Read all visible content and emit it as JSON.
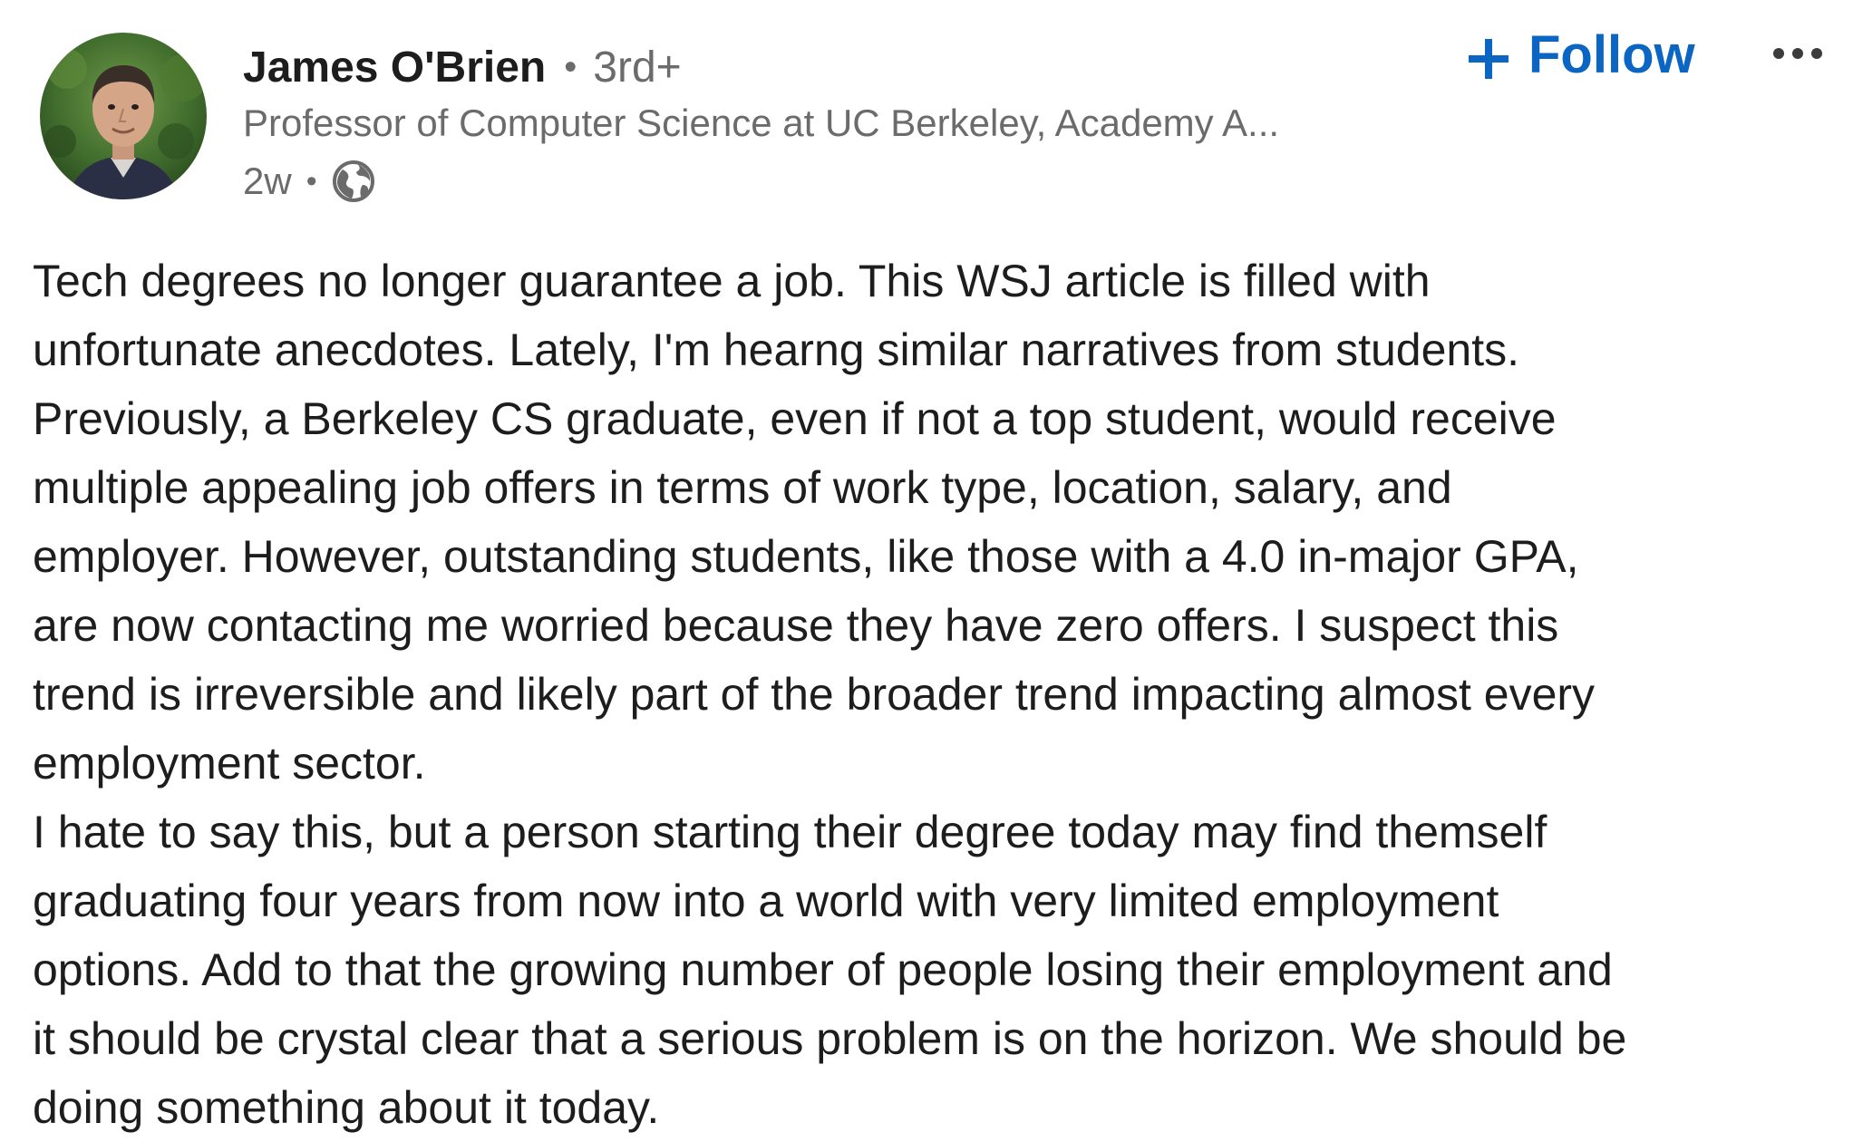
{
  "author": {
    "name": "James O'Brien",
    "degree": "3rd+",
    "headline": "Professor of Computer Science at UC Berkeley, Academy A...",
    "posted_ago": "2w",
    "avatar_icon": "profile-photo",
    "visibility_icon": "globe-icon"
  },
  "actions": {
    "follow_label": "Follow",
    "follow_icon": "plus-icon",
    "more_icon": "more-options-icon"
  },
  "post": {
    "lines": [
      "Tech degrees no longer guarantee a job. This WSJ article is filled with",
      "unfortunate anecdotes. Lately, I'm hearng similar narratives from students.",
      "Previously, a Berkeley CS graduate, even if not a top student, would receive",
      "multiple appealing job offers in terms of work type, location, salary, and",
      "employer. However, outstanding students, like those with a 4.0 in-major GPA,",
      "are now contacting me worried because they have zero offers. I suspect this",
      "trend is irreversible and likely part of the broader trend impacting almost every",
      "employment sector.",
      "I hate to say this, but a person starting their degree today may find themself",
      "graduating four years from now into a world with very limited employment",
      "options. Add to that the growing number of people losing their employment and",
      "it should be crystal clear that a serious problem is on the horizon. We should be",
      "doing something about it today."
    ]
  },
  "colors": {
    "link_blue": "#0a66c2",
    "text_primary": "#1d1d1d",
    "text_secondary": "#6b6b6b"
  }
}
